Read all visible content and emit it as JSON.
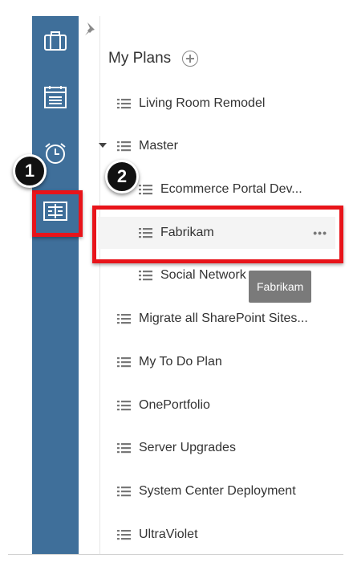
{
  "header": {
    "title": "My Plans"
  },
  "plans": [
    {
      "label": "Living Room Remodel"
    },
    {
      "label": "Master"
    },
    {
      "label": "Ecommerce Portal Dev..."
    },
    {
      "label": "Fabrikam"
    },
    {
      "label": "Social Network"
    },
    {
      "label": "Migrate all SharePoint Sites..."
    },
    {
      "label": "My To Do Plan"
    },
    {
      "label": "OnePortfolio"
    },
    {
      "label": "Server Upgrades"
    },
    {
      "label": "System Center Deployment"
    },
    {
      "label": "UltraViolet"
    }
  ],
  "selected_more": "•••",
  "tooltip": "Fabrikam",
  "callouts": {
    "one": "1",
    "two": "2"
  },
  "colors": {
    "rail": "#3f6f9a",
    "highlight": "#e8141a"
  },
  "icons": [
    "briefcase-icon",
    "calendar-icon",
    "alarm-clock-icon",
    "plans-board-icon",
    "pin-icon",
    "add-icon",
    "list-icon",
    "caret-down-icon",
    "more-icon"
  ]
}
